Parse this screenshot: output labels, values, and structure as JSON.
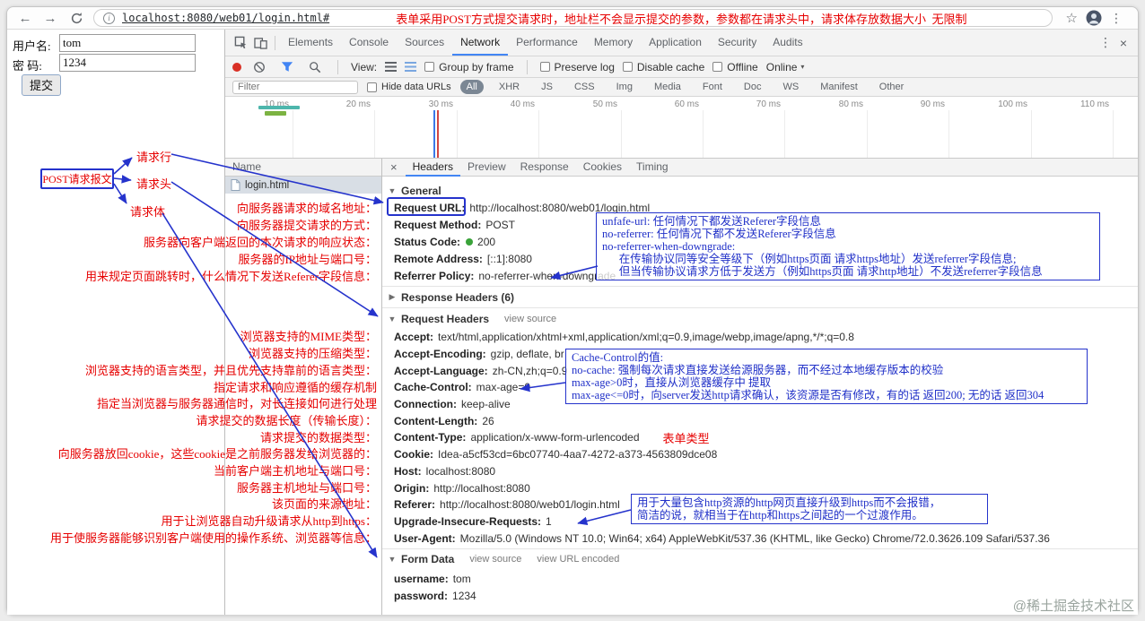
{
  "browser": {
    "url": "localhost:8080/web01/login.html#",
    "annotation": "表单采用POST方式提交请求时，地址栏不会显示提交的参数，参数都在请求头中，请求体存放数据大小  无限制"
  },
  "icons": {
    "back": "←",
    "forward": "→",
    "star": "☆",
    "menu": "⋮",
    "more": "⋮",
    "close": "×",
    "collapse_open": "▼",
    "collapse_closed": "▶",
    "dropdown": "▾"
  },
  "colors": {
    "annotation_red": "#e60000",
    "annotation_blue": "#2533cc",
    "accent_blue": "#4285f4",
    "status_green": "#3aa33a",
    "record_red": "#d93025"
  },
  "login_form": {
    "username_label": "用户名:",
    "username_value": "tom",
    "password_label": "密 码:",
    "password_value": "1234",
    "submit_label": "提交"
  },
  "annotations": {
    "post_message": "POST请求报文",
    "request_line": "请求行",
    "request_header": "请求头",
    "request_body": "请求体",
    "form_type": "表单类型",
    "lines": [
      "向服务器请求的域名地址：",
      "向服务器提交请求的方式：",
      "服务器向客户端返回的本次请求的响应状态：",
      "服务器的IP地址与端口号：",
      "用来规定页面跳转时，什么情况下发送Referer字段信息：",
      "浏览器支持的MIME类型：",
      "浏览器支持的压缩类型：",
      "浏览器支持的语言类型，并且优先支持靠前的语言类型：",
      "指定请求和响应遵循的缓存机制",
      "指定当浏览器与服务器通信时，对长连接如何进行处理",
      "请求提交的数据长度（传输长度）：",
      "请求提交的数据类型：",
      "向服务器放回cookie，这些cookie是之前服务器发给浏览器的：",
      "当前客户端主机地址与端口号：",
      "服务器主机地址与端口号：",
      "该页面的来源地址：",
      "用于让浏览器自动升级请求从http到https：",
      "用于使服务器能够识别客户端使用的操作系统、浏览器等信息："
    ],
    "referrer_box": [
      "unfafe-url: 任何情况下都发送Referer字段信息",
      "no-referrer: 任何情况下都不发送Referer字段信息",
      "no-referrer-when-downgrade:",
      "      在传输协议同等安全等级下（例如https页面 请求https地址）发送referrer字段信息;",
      "      但当传输协议请求方低于发送方（例如https页面 请求http地址）不发送referrer字段信息"
    ],
    "cache_box": [
      "Cache-Control的值:",
      "no-cache: 强制每次请求直接发送给源服务器，而不经过本地缓存版本的校验",
      "max-age>0时，直接从浏览器缓存中 提取",
      "max-age<=0时，向server发送http请求确认，该资源是否有修改，有的话 返回200; 无的话 返回304"
    ],
    "upgrade_box": [
      "用于大量包含http资源的http网页直接升级到https而不会报错，",
      "简洁的说，就相当于在http和https之间起的一个过渡作用。"
    ]
  },
  "devtools": {
    "tabs": [
      "Elements",
      "Console",
      "Sources",
      "Network",
      "Performance",
      "Memory",
      "Application",
      "Security",
      "Audits"
    ],
    "active_tab": "Network",
    "toolbar": {
      "view_label": "View:",
      "group_by_frame": "Group by frame",
      "preserve_log": "Preserve log",
      "disable_cache": "Disable cache",
      "offline": "Offline",
      "online": "Online"
    },
    "filter_bar": {
      "placeholder": "Filter",
      "hide_data_urls": "Hide data URLs",
      "types": [
        "All",
        "XHR",
        "JS",
        "CSS",
        "Img",
        "Media",
        "Font",
        "Doc",
        "WS",
        "Manifest",
        "Other"
      ],
      "active_type": "All"
    },
    "timeline_ticks": [
      "10 ms",
      "20 ms",
      "30 ms",
      "40 ms",
      "50 ms",
      "60 ms",
      "70 ms",
      "80 ms",
      "90 ms",
      "100 ms",
      "110 ms"
    ],
    "request_table": {
      "name_header": "Name",
      "row": "login.html"
    },
    "detail": {
      "tabs": [
        "Headers",
        "Preview",
        "Response",
        "Cookies",
        "Timing"
      ],
      "active_tab": "Headers",
      "sections": {
        "general": {
          "title": "General",
          "items": [
            {
              "name": "Request URL:",
              "value": "http://localhost:8080/web01/login.html"
            },
            {
              "name": "Request Method:",
              "value": "POST"
            },
            {
              "name": "Status Code:",
              "value": "200"
            },
            {
              "name": "Remote Address:",
              "value": "[::1]:8080"
            },
            {
              "name": "Referrer Policy:",
              "value": "no-referrer-when-downgrade"
            }
          ]
        },
        "response_headers": {
          "title": "Response Headers (6)"
        },
        "request_headers": {
          "title": "Request Headers",
          "view_source": "view source",
          "items": [
            {
              "name": "Accept:",
              "value": "text/html,application/xhtml+xml,application/xml;q=0.9,image/webp,image/apng,*/*;q=0.8"
            },
            {
              "name": "Accept-Encoding:",
              "value": "gzip, deflate, br"
            },
            {
              "name": "Accept-Language:",
              "value": "zh-CN,zh;q=0.9"
            },
            {
              "name": "Cache-Control:",
              "value": "max-age=0"
            },
            {
              "name": "Connection:",
              "value": "keep-alive"
            },
            {
              "name": "Content-Length:",
              "value": "26"
            },
            {
              "name": "Content-Type:",
              "value": "application/x-www-form-urlencoded"
            },
            {
              "name": "Cookie:",
              "value": "Idea-a5cf53cd=6bc07740-4aa7-4272-a373-4563809dce08"
            },
            {
              "name": "Host:",
              "value": "localhost:8080"
            },
            {
              "name": "Origin:",
              "value": "http://localhost:8080"
            },
            {
              "name": "Referer:",
              "value": "http://localhost:8080/web01/login.html"
            },
            {
              "name": "Upgrade-Insecure-Requests:",
              "value": "1"
            },
            {
              "name": "User-Agent:",
              "value": "Mozilla/5.0 (Windows NT 10.0; Win64; x64) AppleWebKit/537.36 (KHTML, like Gecko) Chrome/72.0.3626.109 Safari/537.36"
            }
          ]
        },
        "form_data": {
          "title": "Form Data",
          "view_source": "view source",
          "view_url_encoded": "view URL encoded",
          "items": [
            {
              "name": "username:",
              "value": "tom"
            },
            {
              "name": "password:",
              "value": "1234"
            }
          ]
        }
      }
    }
  },
  "watermark": "@稀土掘金技术社区"
}
